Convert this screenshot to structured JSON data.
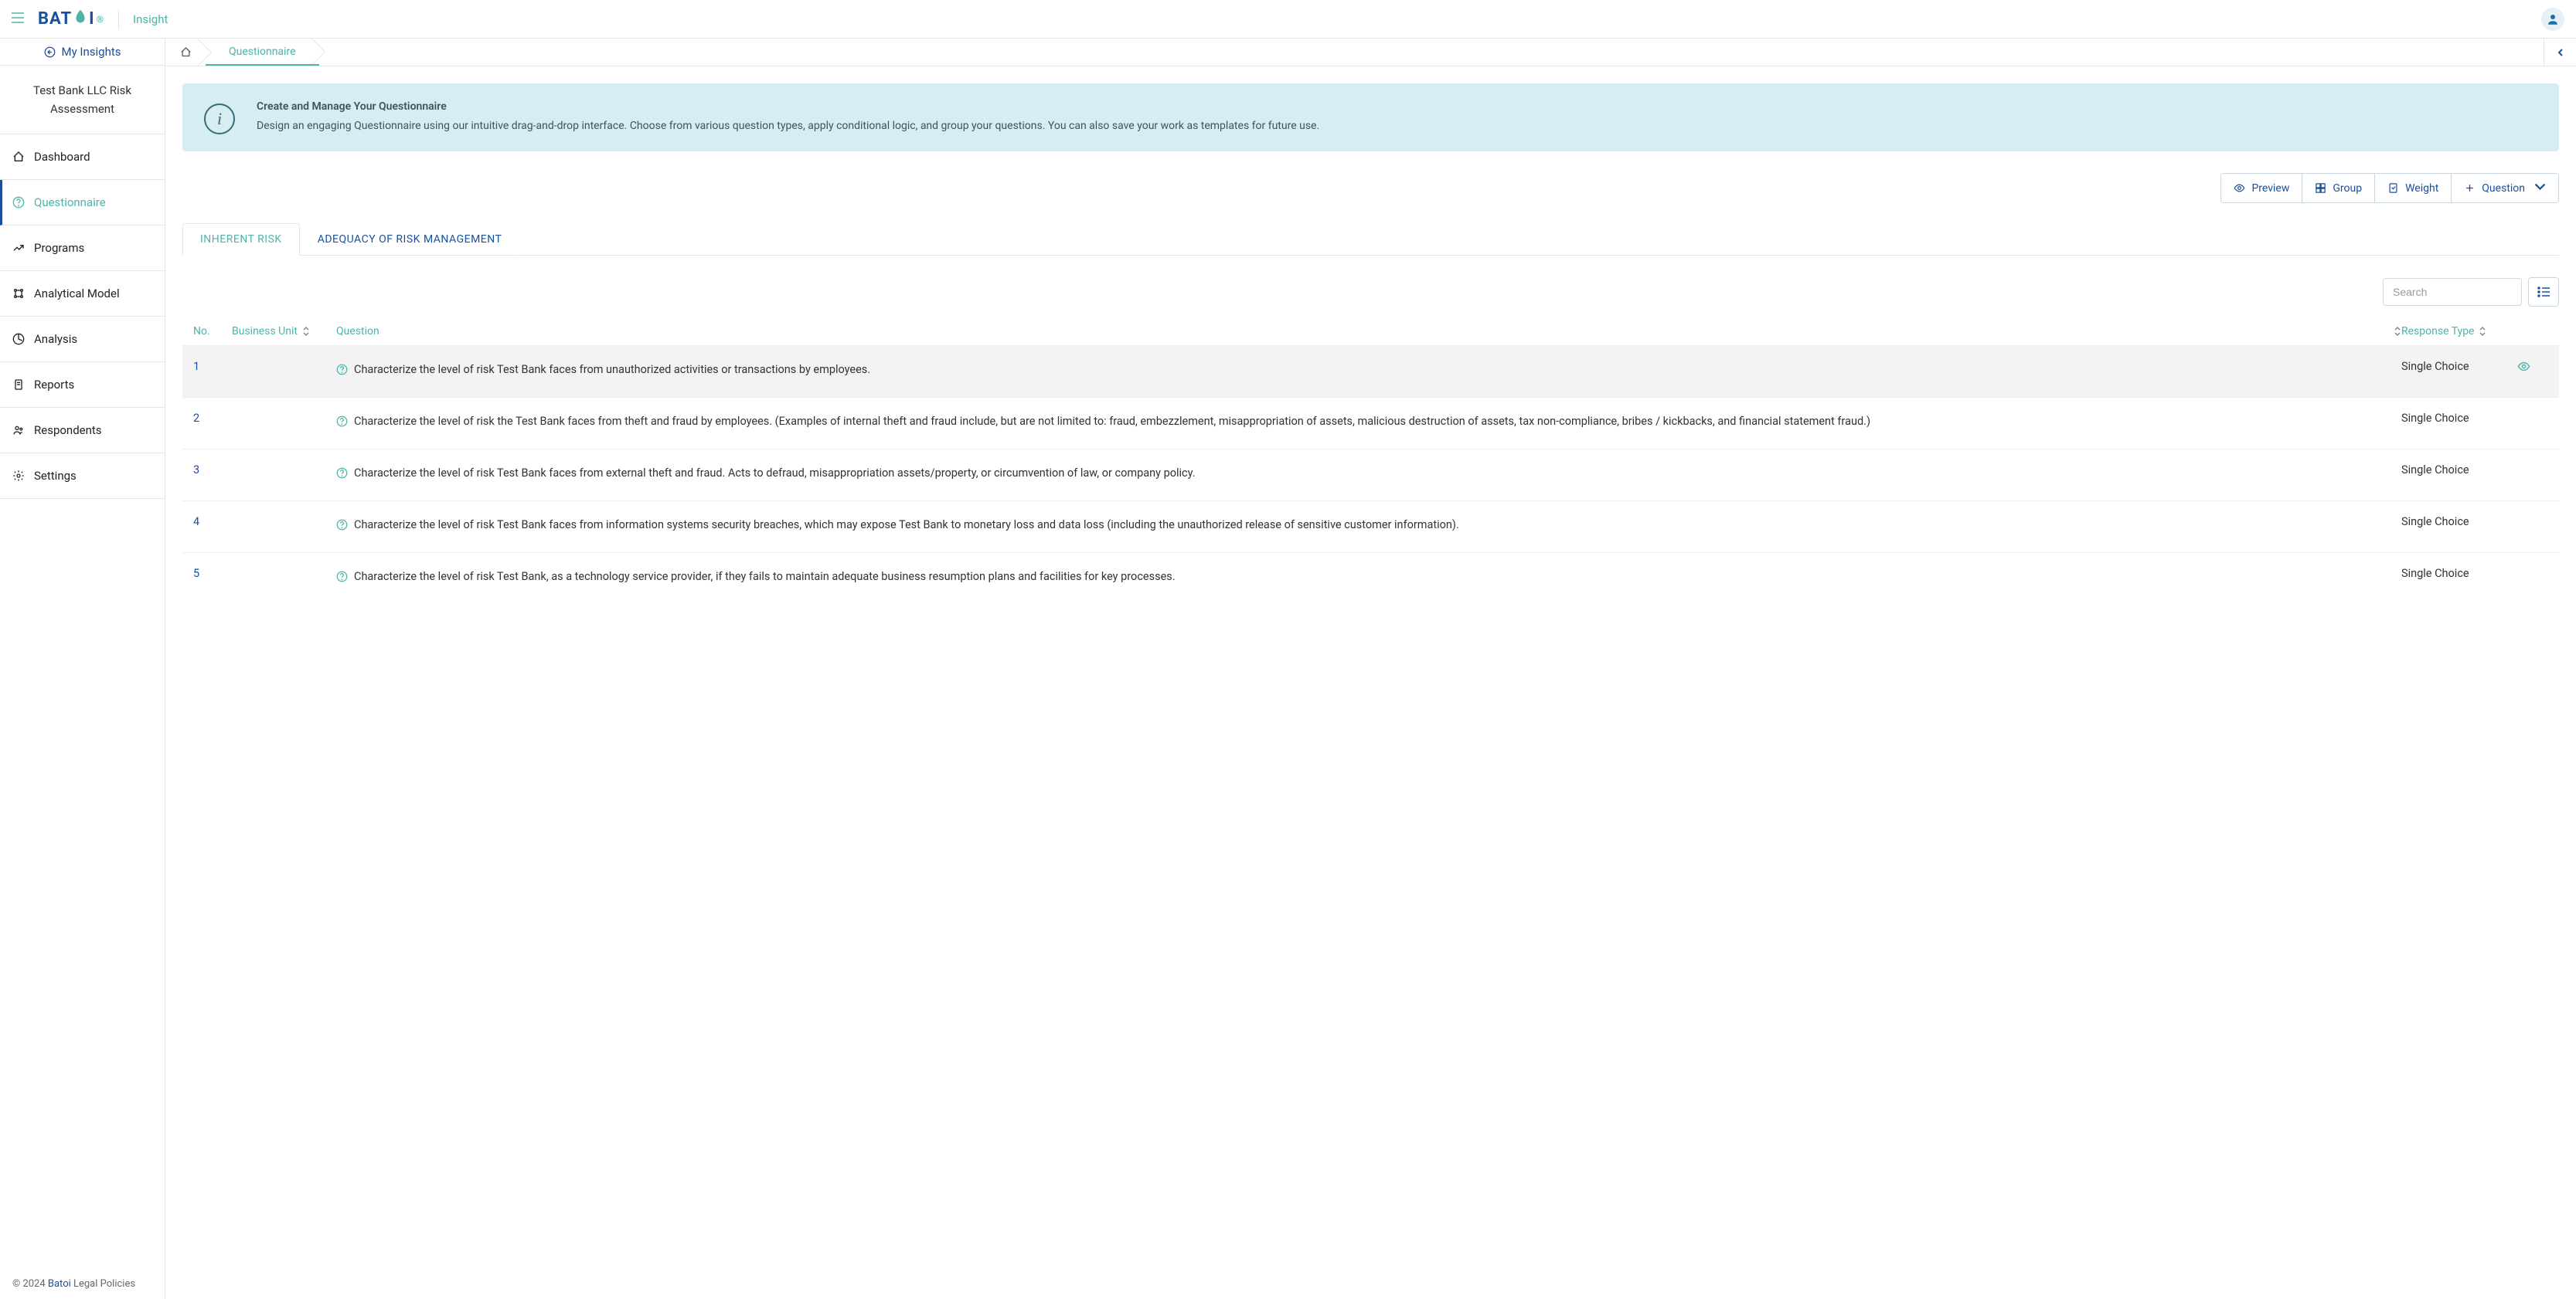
{
  "topbar": {
    "logo_prefix": "BAT",
    "logo_suffix": "I",
    "product": "Insight"
  },
  "sidebar": {
    "my_insights": "My Insights",
    "project_title": "Test Bank LLC Risk Assessment",
    "items": [
      {
        "label": "Dashboard"
      },
      {
        "label": "Questionnaire"
      },
      {
        "label": "Programs"
      },
      {
        "label": "Analytical Model"
      },
      {
        "label": "Analysis"
      },
      {
        "label": "Reports"
      },
      {
        "label": "Respondents"
      },
      {
        "label": "Settings"
      }
    ],
    "footer_prefix": "© 2024 ",
    "footer_link": "Batoi",
    "footer_suffix": " Legal Policies"
  },
  "breadcrumb": {
    "current": "Questionnaire"
  },
  "info": {
    "title": "Create and Manage Your Questionnaire",
    "desc": "Design an engaging Questionnaire using our intuitive drag-and-drop interface. Choose from various question types, apply conditional logic, and group your questions. You can also save your work as templates for future use."
  },
  "actions": {
    "preview": "Preview",
    "group": "Group",
    "weight": "Weight",
    "question": "Question"
  },
  "tabs": [
    "INHERENT RISK",
    "ADEQUACY OF RISK MANAGEMENT"
  ],
  "search_placeholder": "Search",
  "headers": {
    "no": "No.",
    "bu": "Business Unit",
    "q": "Question",
    "rt": "Response Type"
  },
  "rows": [
    {
      "no": "1",
      "q": "Characterize the level of risk Test Bank faces from unauthorized activities or transactions by employees.",
      "rt": "Single Choice"
    },
    {
      "no": "2",
      "q": "Characterize the level of risk the Test Bank faces from theft and fraud by employees. (Examples of internal theft and fraud include, but are not limited to: fraud, embezzlement, misappropriation of assets, malicious destruction of assets, tax non-compliance, bribes / kickbacks, and financial statement fraud.)",
      "rt": "Single Choice"
    },
    {
      "no": "3",
      "q": "Characterize the level of risk Test Bank faces from external theft and fraud. Acts to defraud, misappropriation assets/property, or circumvention of law, or company policy.",
      "rt": "Single Choice"
    },
    {
      "no": "4",
      "q": "Characterize the level of risk Test Bank faces from information systems security breaches, which may expose Test Bank to monetary loss and data loss (including the unauthorized release of sensitive customer information).",
      "rt": "Single Choice"
    },
    {
      "no": "5",
      "q": "Characterize the level of risk Test Bank, as a technology service provider, if they fails to maintain adequate business resumption plans and facilities for key processes.",
      "rt": "Single Choice"
    }
  ]
}
